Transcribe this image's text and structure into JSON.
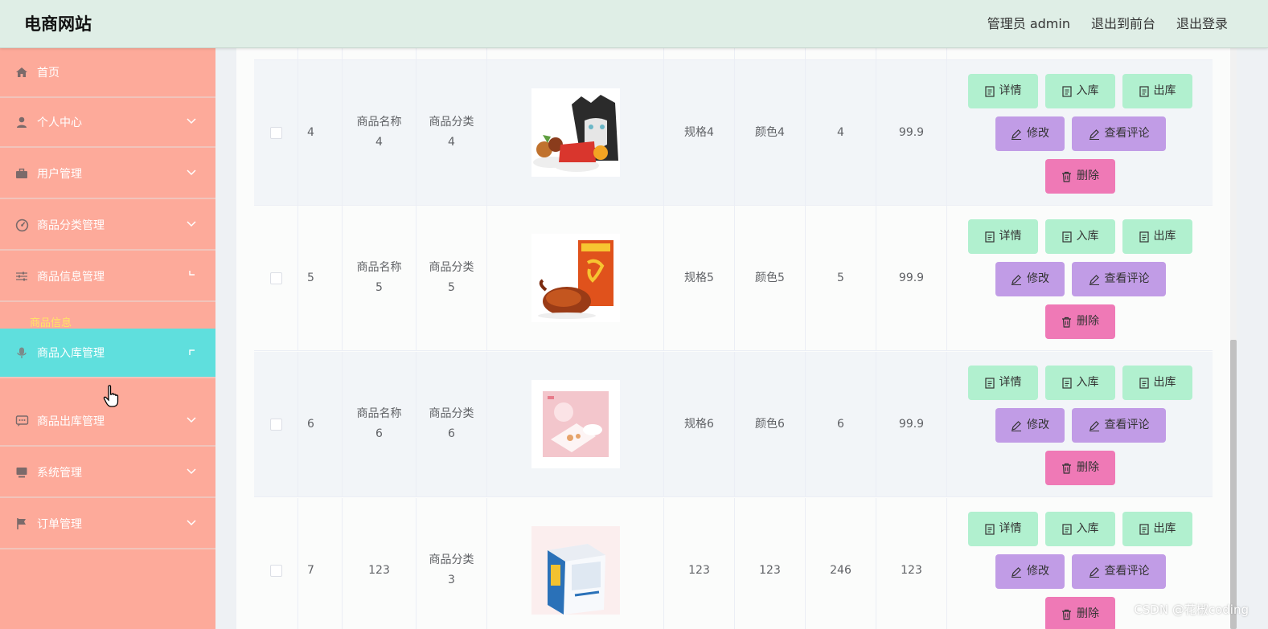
{
  "header": {
    "brand": "电商网站",
    "admin_label": "管理员 admin",
    "front_label": "退出到前台",
    "logout_label": "退出登录"
  },
  "sidebar": {
    "items": [
      {
        "label": "首页",
        "icon": "home-icon"
      },
      {
        "label": "个人中心",
        "icon": "user-icon"
      },
      {
        "label": "用户管理",
        "icon": "briefcase-icon"
      },
      {
        "label": "商品分类管理",
        "icon": "dashboard-icon"
      },
      {
        "label": "商品信息管理",
        "icon": "sliders-icon"
      },
      {
        "label": "商品入库管理",
        "icon": "microphone-icon"
      },
      {
        "label": "商品出库管理",
        "icon": "chat-icon"
      },
      {
        "label": "系统管理",
        "icon": "monitor-icon"
      },
      {
        "label": "订单管理",
        "icon": "flag-icon"
      }
    ],
    "submenu_label": "商品信息"
  },
  "table": {
    "rows": [
      {
        "id": "4",
        "name": [
          "商品名称",
          "4"
        ],
        "category": [
          "商品分类",
          "4"
        ],
        "spec": "规格4",
        "color": "颜色4",
        "count": "4",
        "price": "99.9"
      },
      {
        "id": "5",
        "name": [
          "商品名称",
          "5"
        ],
        "category": [
          "商品分类",
          "5"
        ],
        "spec": "规格5",
        "color": "颜色5",
        "count": "5",
        "price": "99.9"
      },
      {
        "id": "6",
        "name": [
          "商品名称",
          "6"
        ],
        "category": [
          "商品分类",
          "6"
        ],
        "spec": "规格6",
        "color": "颜色6",
        "count": "6",
        "price": "99.9"
      },
      {
        "id": "7",
        "name": [
          "123",
          ""
        ],
        "category": [
          "商品分类",
          "3"
        ],
        "spec": "123",
        "color": "123",
        "count": "246",
        "price": "123"
      }
    ],
    "actions": {
      "detail": "详情",
      "stock_in": "入库",
      "stock_out": "出库",
      "edit": "修改",
      "reviews": "查看评论",
      "delete": "删除"
    }
  },
  "colors": {
    "header_bg": "#dfeee6",
    "sidebar_bg": "#fdaa9a",
    "active_menu": "#5fdfdd",
    "btn_green": "#b1f0cf",
    "btn_purple": "#c19ce6",
    "btn_pink": "#ef79b6"
  },
  "watermark": "CSDN @花椒coding"
}
